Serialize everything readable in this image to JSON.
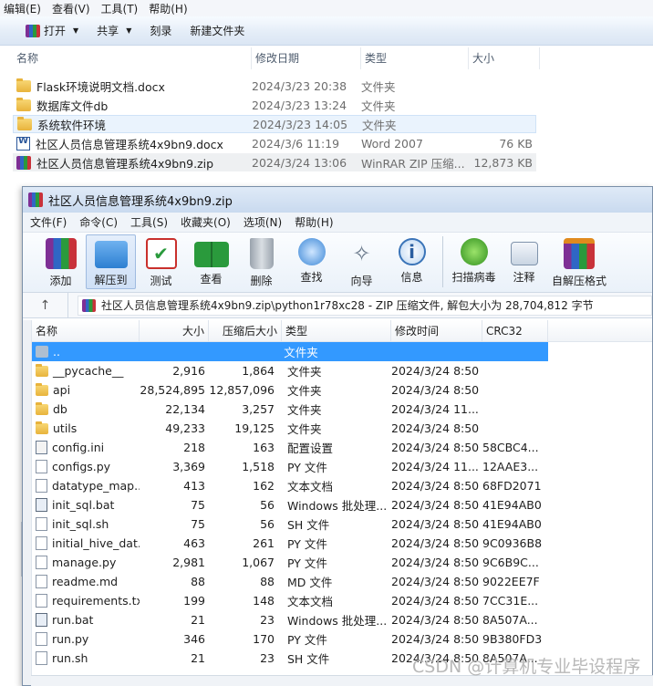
{
  "explorer": {
    "menu": [
      "编辑(E)",
      "查看(V)",
      "工具(T)",
      "帮助(H)"
    ],
    "toolbar": {
      "open": "打开",
      "share": "共享",
      "burn": "刻录",
      "new_folder": "新建文件夹"
    },
    "columns": {
      "name": "名称",
      "date": "修改日期",
      "type": "类型",
      "size": "大小"
    },
    "files": [
      {
        "icon": "folder-icon",
        "name": "Flask环境说明文档.docx",
        "date": "2024/3/23 20:38",
        "type": "文件夹",
        "size": ""
      },
      {
        "icon": "folder-icon",
        "name": "数据库文件db",
        "date": "2024/3/23 13:24",
        "type": "文件夹",
        "size": ""
      },
      {
        "icon": "folder-icon",
        "name": "系统软件环境",
        "date": "2024/3/23 14:05",
        "type": "文件夹",
        "size": ""
      },
      {
        "icon": "word-doc-icon",
        "name": "社区人员信息管理系统4x9bn9.docx",
        "date": "2024/3/6 11:19",
        "type": "Word 2007",
        "size": "76 KB"
      },
      {
        "icon": "rar-archive-icon",
        "name": "社区人员信息管理系统4x9bn9.zip",
        "date": "2024/3/24 13:06",
        "type": "WinRAR ZIP 压缩...",
        "size": "12,873 KB"
      }
    ]
  },
  "winrar": {
    "title": "社区人员信息管理系统4x9bn9.zip",
    "menu": [
      "文件(F)",
      "命令(C)",
      "工具(S)",
      "收藏夹(O)",
      "选项(N)",
      "帮助(H)"
    ],
    "toolbar": {
      "add": "添加",
      "extract": "解压到",
      "test": "测试",
      "view": "查看",
      "delete": "删除",
      "find": "查找",
      "wizard": "向导",
      "info": "信息",
      "scan": "扫描病毒",
      "comment": "注释",
      "sfx": "自解压格式"
    },
    "address": "社区人员信息管理系统4x9bn9.zip\\python1r78xc28 - ZIP 压缩文件, 解包大小为 28,704,812 字节",
    "columns": {
      "name": "名称",
      "size": "大小",
      "csize": "压缩后大小",
      "type": "类型",
      "mtime": "修改时间",
      "crc": "CRC32"
    },
    "rows": [
      {
        "icon": "up-folder-icon",
        "name": "..",
        "size": "",
        "csize": "",
        "type": "文件夹",
        "mtime": "",
        "crc": ""
      },
      {
        "icon": "folder-icon",
        "name": "__pycache__",
        "size": "2,916",
        "csize": "1,864",
        "type": "文件夹",
        "mtime": "2024/3/24 8:50",
        "crc": ""
      },
      {
        "icon": "folder-icon",
        "name": "api",
        "size": "28,524,895",
        "csize": "12,857,096",
        "type": "文件夹",
        "mtime": "2024/3/24 8:50",
        "crc": ""
      },
      {
        "icon": "folder-icon",
        "name": "db",
        "size": "22,134",
        "csize": "3,257",
        "type": "文件夹",
        "mtime": "2024/3/24 11...",
        "crc": ""
      },
      {
        "icon": "folder-icon",
        "name": "utils",
        "size": "49,233",
        "csize": "19,125",
        "type": "文件夹",
        "mtime": "2024/3/24 8:50",
        "crc": ""
      },
      {
        "icon": "config-file-icon",
        "name": "config.ini",
        "size": "218",
        "csize": "163",
        "type": "配置设置",
        "mtime": "2024/3/24 8:50",
        "crc": "58CBC4..."
      },
      {
        "icon": "file-icon",
        "name": "configs.py",
        "size": "3,369",
        "csize": "1,518",
        "type": "PY 文件",
        "mtime": "2024/3/24 11...",
        "crc": "12AAE3..."
      },
      {
        "icon": "file-icon",
        "name": "datatype_map....",
        "size": "413",
        "csize": "162",
        "type": "文本文档",
        "mtime": "2024/3/24 8:50",
        "crc": "68FD2071"
      },
      {
        "icon": "bat-file-icon",
        "name": "init_sql.bat",
        "size": "75",
        "csize": "56",
        "type": "Windows 批处理...",
        "mtime": "2024/3/24 8:50",
        "crc": "41E94AB0"
      },
      {
        "icon": "file-icon",
        "name": "init_sql.sh",
        "size": "75",
        "csize": "56",
        "type": "SH 文件",
        "mtime": "2024/3/24 8:50",
        "crc": "41E94AB0"
      },
      {
        "icon": "file-icon",
        "name": "initial_hive_dat...",
        "size": "463",
        "csize": "261",
        "type": "PY 文件",
        "mtime": "2024/3/24 8:50",
        "crc": "9C0936B8"
      },
      {
        "icon": "file-icon",
        "name": "manage.py",
        "size": "2,981",
        "csize": "1,067",
        "type": "PY 文件",
        "mtime": "2024/3/24 8:50",
        "crc": "9C6B9C..."
      },
      {
        "icon": "file-icon",
        "name": "readme.md",
        "size": "88",
        "csize": "88",
        "type": "MD 文件",
        "mtime": "2024/3/24 8:50",
        "crc": "9022EE7F"
      },
      {
        "icon": "file-icon",
        "name": "requirements.txt",
        "size": "199",
        "csize": "148",
        "type": "文本文档",
        "mtime": "2024/3/24 8:50",
        "crc": "7CC31E..."
      },
      {
        "icon": "bat-file-icon",
        "name": "run.bat",
        "size": "21",
        "csize": "23",
        "type": "Windows 批处理...",
        "mtime": "2024/3/24 8:50",
        "crc": "8A507A..."
      },
      {
        "icon": "file-icon",
        "name": "run.py",
        "size": "346",
        "csize": "170",
        "type": "PY 文件",
        "mtime": "2024/3/24 8:50",
        "crc": "9B380FD3"
      },
      {
        "icon": "file-icon",
        "name": "run.sh",
        "size": "21",
        "csize": "23",
        "type": "SH 文件",
        "mtime": "2024/3/24 8:50",
        "crc": "8A507A..."
      }
    ]
  },
  "watermark": "CSDN @计算机专业毕设程序"
}
